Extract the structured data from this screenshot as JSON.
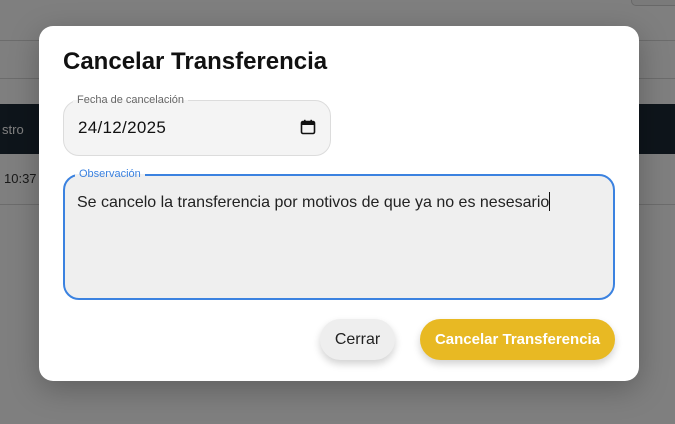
{
  "background": {
    "table_header_col": "stro",
    "table_row_cell": "10:37"
  },
  "dialog": {
    "title": "Cancelar Transferencia",
    "date_field": {
      "label": "Fecha de cancelación",
      "value": "24/12/2025",
      "icon": "calendar-icon"
    },
    "observation_field": {
      "label": "Observación",
      "value": "Se cancelo la transferencia por motivos de que ya no es nesesario"
    },
    "buttons": {
      "close_label": "Cerrar",
      "confirm_label": "Cancelar Transferencia"
    }
  },
  "colors": {
    "accent": "#e8b923",
    "focus": "#3b82e0",
    "table_header": "#1d2b36"
  }
}
